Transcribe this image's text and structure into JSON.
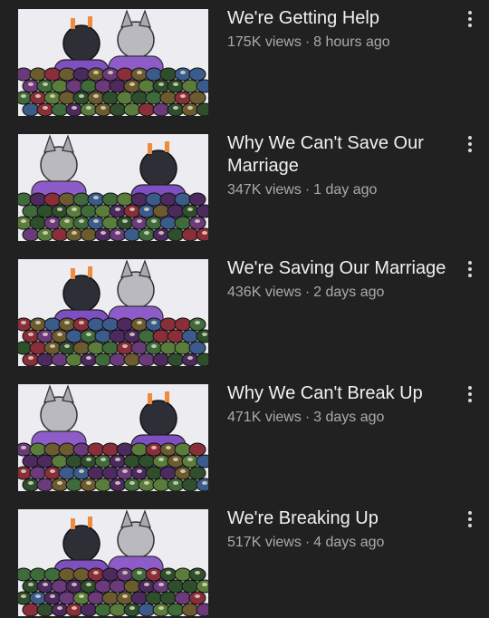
{
  "videos": [
    {
      "title": "We're Getting Help",
      "views": "175K views",
      "age": "8 hours ago"
    },
    {
      "title": "Why We Can't Save Our Marriage",
      "views": "347K views",
      "age": "1 day ago"
    },
    {
      "title": "We're Saving Our Marriage",
      "views": "436K views",
      "age": "2 days ago"
    },
    {
      "title": "Why We Can't Break Up",
      "views": "471K views",
      "age": "3 days ago"
    },
    {
      "title": "We're Breaking Up",
      "views": "517K views",
      "age": "4 days ago"
    }
  ],
  "meta_separator": "·",
  "icons": {
    "menu": "more-vert-icon"
  },
  "colors": {
    "background": "#212121",
    "title": "#f1f1f1",
    "meta": "#aaaaaa"
  }
}
